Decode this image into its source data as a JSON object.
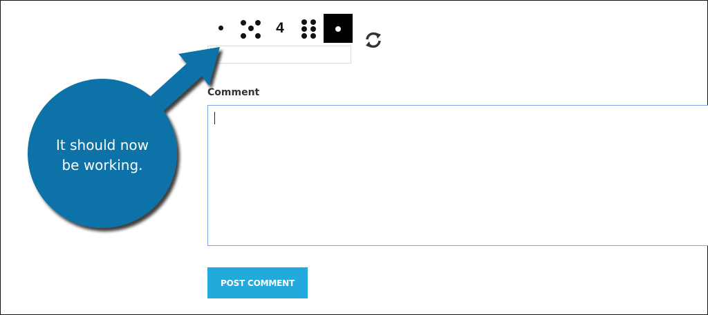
{
  "captcha": {
    "tiles": [
      {
        "kind": "die",
        "value": 1,
        "style": "plain"
      },
      {
        "kind": "die",
        "value": 5,
        "style": "plain"
      },
      {
        "kind": "digit",
        "value": "4",
        "style": "plain"
      },
      {
        "kind": "die",
        "value": 6,
        "style": "plain"
      },
      {
        "kind": "die",
        "value": 1,
        "style": "inverse"
      }
    ],
    "input_value": "",
    "refresh_icon": "refresh-icon"
  },
  "comment": {
    "label": "Comment",
    "value": ""
  },
  "submit": {
    "label": "POST COMMENT"
  },
  "annotation": {
    "text_line1": "It should now",
    "text_line2": "be working.",
    "color": "#0a72a8"
  },
  "colors": {
    "button": "#23a9dc",
    "textarea_border": "#7aa7e6"
  }
}
